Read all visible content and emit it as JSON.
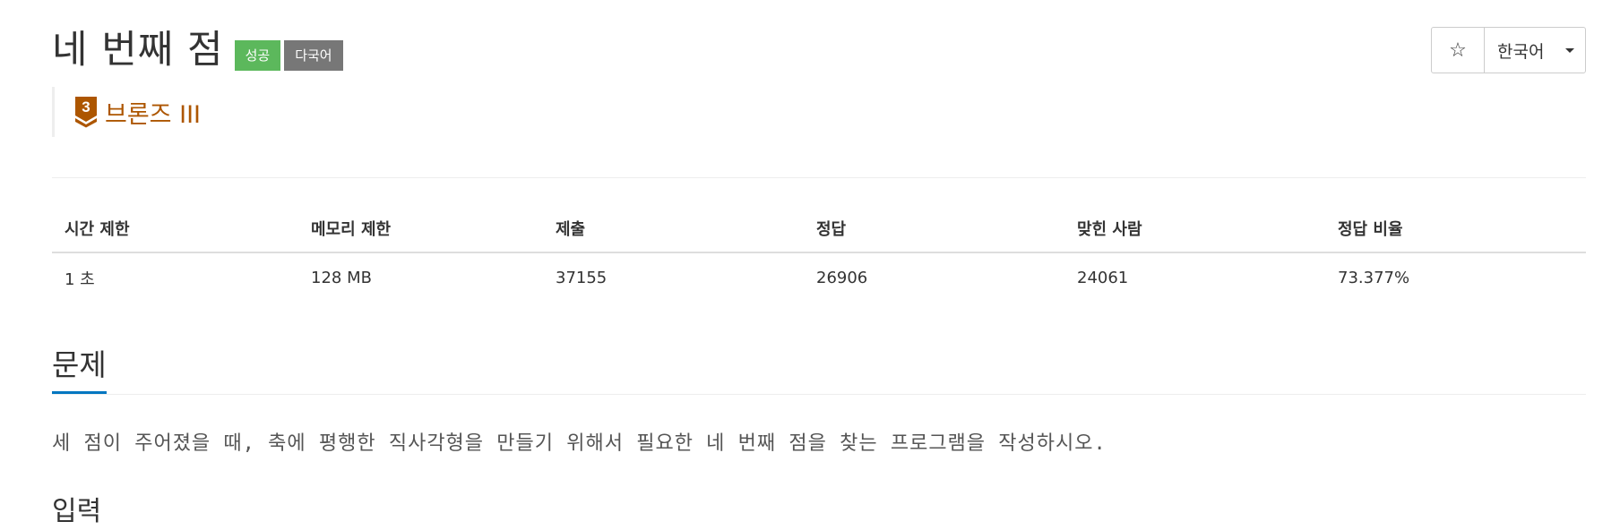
{
  "problem": {
    "title": "네 번째 점",
    "badges": [
      "성공",
      "다국어"
    ],
    "tier": {
      "label": "브론즈 III",
      "number": "3",
      "color": "#ad5600"
    }
  },
  "controls": {
    "star_icon": "star-outline-icon",
    "star_glyph": "☆",
    "language": "한국어"
  },
  "info_table": {
    "headers": [
      "시간 제한",
      "메모리 제한",
      "제출",
      "정답",
      "맞힌 사람",
      "정답 비율"
    ],
    "values": [
      "1 초",
      "128 MB",
      "37155",
      "26906",
      "24061",
      "73.377%"
    ]
  },
  "sections": {
    "problem_title": "문제",
    "problem_body": "세 점이 주어졌을 때, 축에 평행한 직사각형을 만들기 위해서 필요한 네 번째 점을 찾는 프로그램을 작성하시오.",
    "input_title": "입력"
  },
  "colors": {
    "success": "#5cb85c",
    "multilang": "#777777",
    "accent": "#0076c0",
    "bronze": "#ad5600"
  }
}
